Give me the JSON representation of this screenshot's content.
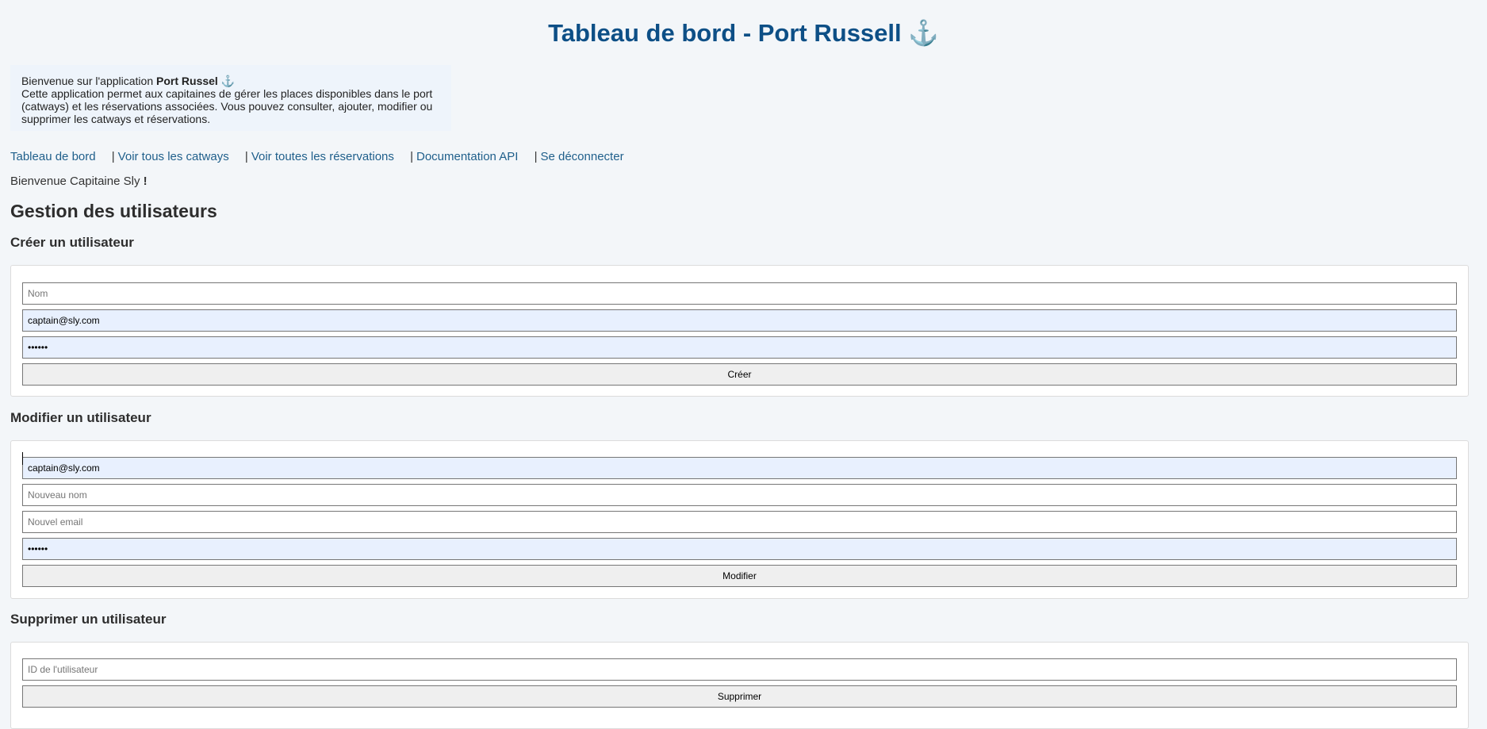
{
  "header": {
    "title": "Tableau de bord - Port Russell",
    "title_icon": "⚓"
  },
  "intro": {
    "welcome_prefix": "Bienvenue sur l'application",
    "app_name": "Port Russel",
    "app_icon": "⚓",
    "description": "Cette application permet aux capitaines de gérer les places disponibles dans le port (catways) et les réservations associées. Vous pouvez consulter, ajouter, modifier ou supprimer les catways et réservations."
  },
  "nav": {
    "dashboard": "Tableau de bord",
    "catways": "Voir tous les catways",
    "reservations": "Voir toutes les réservations",
    "api_docs": "Documentation API",
    "logout": "Se déconnecter",
    "separator": "|"
  },
  "welcome": {
    "text": "Bienvenue Capitaine Sly",
    "exclamation": "!"
  },
  "users": {
    "title": "Gestion des utilisateurs",
    "create": {
      "title": "Créer un utilisateur",
      "name_placeholder": "Nom",
      "email_value": "captain@sly.com",
      "password_value": "••••••",
      "submit_label": "Créer"
    },
    "update": {
      "title": "Modifier un utilisateur",
      "current_email_value": "captain@sly.com",
      "new_name_placeholder": "Nouveau nom",
      "new_email_placeholder": "Nouvel email",
      "password_value": "••••••",
      "submit_label": "Modifier"
    },
    "delete": {
      "title": "Supprimer un utilisateur",
      "id_placeholder": "ID de l'utilisateur",
      "submit_label": "Supprimer"
    }
  },
  "colors": {
    "page_background": "#f3f6f9",
    "title": "#0d4f86",
    "link": "#1f5f8b",
    "autofill": "#e8f0fe"
  }
}
